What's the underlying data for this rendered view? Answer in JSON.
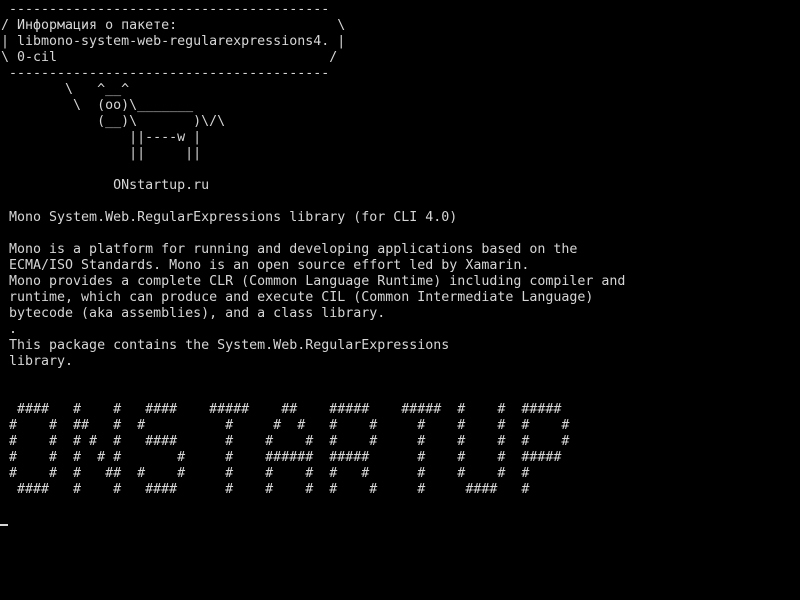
{
  "terminal": {
    "lines": [
      " ----------------------------------------",
      "/ Информация о пакете:                    \\",
      "| libmono-system-web-regularexpressions4. |",
      "\\ 0-cil                                  /",
      " ----------------------------------------",
      "        \\   ^__^",
      "         \\  (oo)\\_______",
      "            (__)\\       )\\/\\",
      "                ||----w |",
      "                ||     ||",
      "",
      "              ONstartup.ru",
      "",
      " Mono System.Web.RegularExpressions library (for CLI 4.0)",
      "",
      " Mono is a platform for running and developing applications based on the",
      " ECMA/ISO Standards. Mono is an open source effort led by Xamarin.",
      " Mono provides a complete CLR (Common Language Runtime) including compiler and",
      " runtime, which can produce and execute CIL (Common Intermediate Language)",
      " bytecode (aka assemblies), and a class library.",
      " .",
      " This package contains the System.Web.RegularExpressions",
      " library.",
      "",
      "",
      "  ####   #    #   ####    #####    ##    #####    #####  #    #  #####",
      " #    #  ##   #  #          #     #  #   #    #     #    #    #  #    #",
      " #    #  # #  #   ####      #    #    #  #    #     #    #    #  #    #",
      " #    #  #  # #       #     #    ######  #####      #    #    #  #####",
      " #    #  #   ##  #    #     #    #    #  #   #      #    #    #  #",
      "  ####   #    #   ####      #    #    #  #    #     #     ####   #"
    ]
  }
}
